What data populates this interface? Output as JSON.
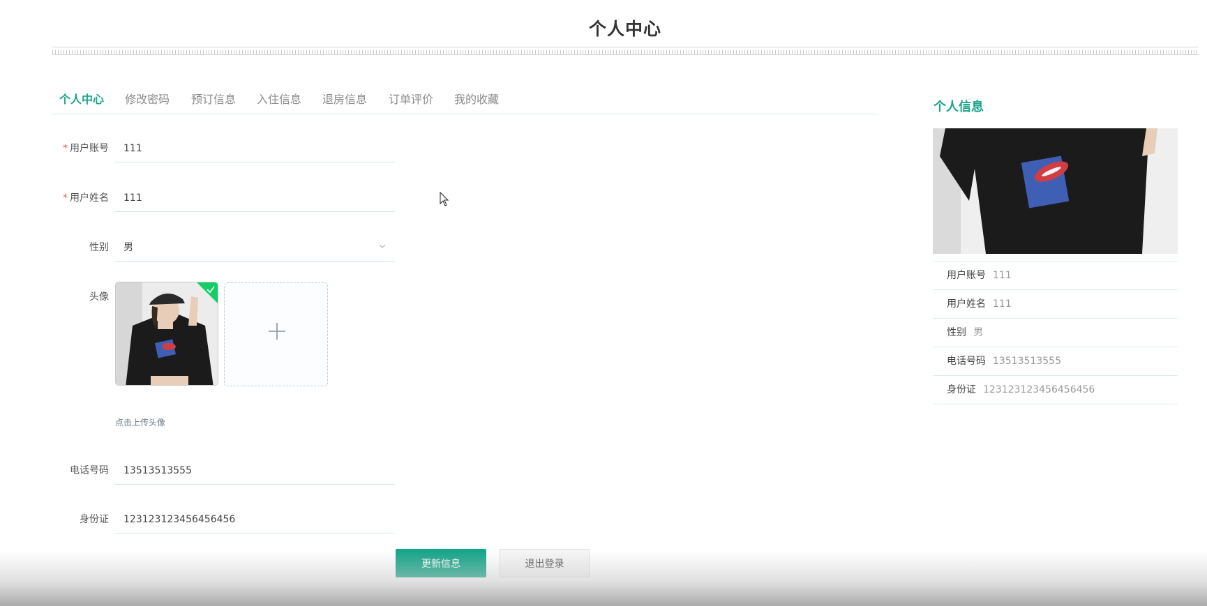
{
  "page": {
    "title": "个人中心"
  },
  "tabs": [
    {
      "label": "个人中心",
      "active": true
    },
    {
      "label": "修改密码",
      "active": false
    },
    {
      "label": "预订信息",
      "active": false
    },
    {
      "label": "入住信息",
      "active": false
    },
    {
      "label": "退房信息",
      "active": false
    },
    {
      "label": "订单评价",
      "active": false
    },
    {
      "label": "我的收藏",
      "active": false
    }
  ],
  "form": {
    "account": {
      "label": "用户账号",
      "value": "111",
      "required": true
    },
    "name": {
      "label": "用户姓名",
      "value": "111",
      "required": true
    },
    "gender": {
      "label": "性别",
      "value": "男"
    },
    "avatar": {
      "label": "头像",
      "tip": "点击上传头像"
    },
    "phone": {
      "label": "电话号码",
      "value": "13513513555"
    },
    "idcard": {
      "label": "身份证",
      "value": "123123123456456456"
    },
    "required_mark": "*"
  },
  "buttons": {
    "update": "更新信息",
    "logout": "退出登录"
  },
  "sidebar": {
    "title": "个人信息",
    "items": [
      {
        "key": "用户账号",
        "value": "111"
      },
      {
        "key": "用户姓名",
        "value": "111"
      },
      {
        "key": "性别",
        "value": "男"
      },
      {
        "key": "电话号码",
        "value": "13513513555"
      },
      {
        "key": "身份证",
        "value": "123123123456456456"
      }
    ]
  },
  "colors": {
    "accent": "#17a589",
    "required": "#e15b5b",
    "success": "#13ce66"
  },
  "icons": [
    "chevron-down-icon",
    "check-icon",
    "plus-icon",
    "mouse-cursor-icon"
  ]
}
